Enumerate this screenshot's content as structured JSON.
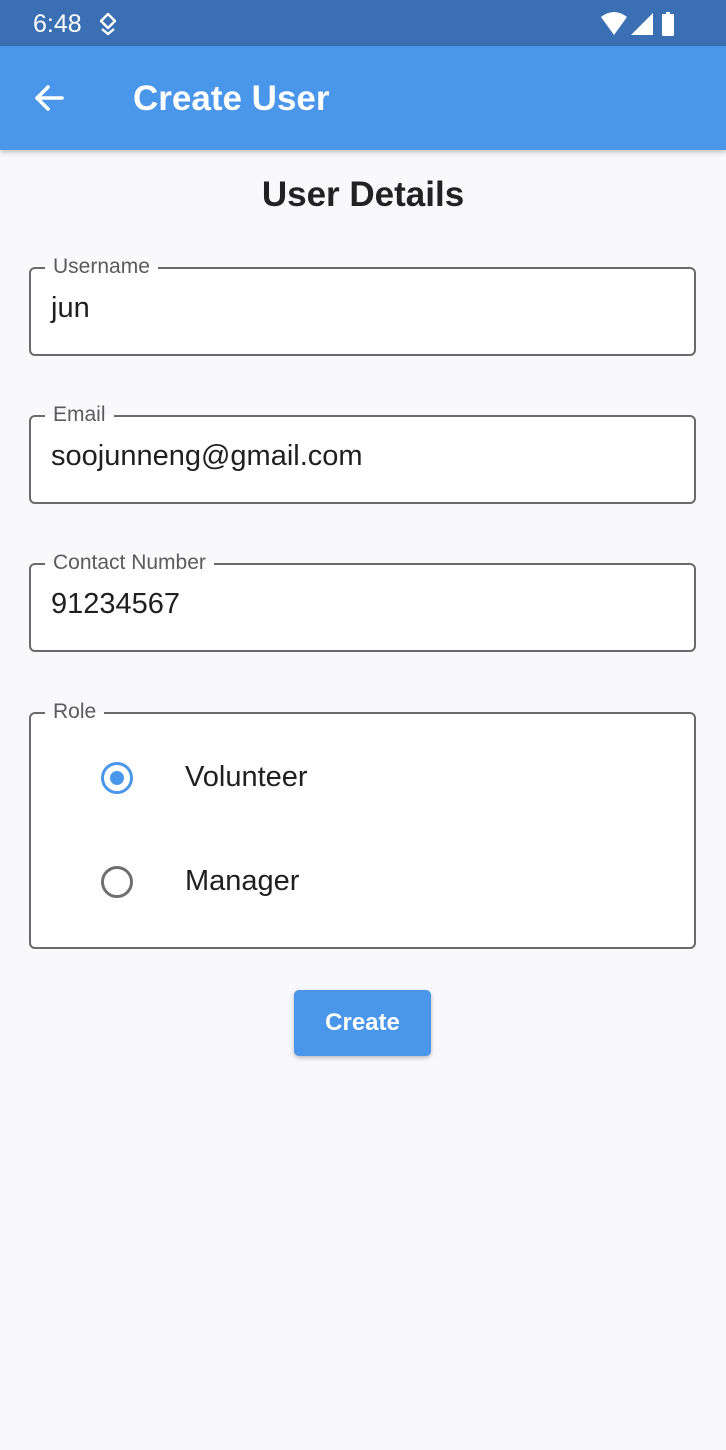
{
  "status_bar": {
    "time": "6:48",
    "icons": [
      "notification-icon",
      "wifi-icon",
      "signal-icon",
      "battery-icon"
    ]
  },
  "app_bar": {
    "title": "Create User",
    "back_icon": "arrow-back-icon",
    "color": "#4a96eb"
  },
  "form": {
    "section_title": "User Details",
    "username": {
      "label": "Username",
      "value": "jun"
    },
    "email": {
      "label": "Email",
      "value": "soojunneng@gmail.com"
    },
    "contact": {
      "label": "Contact Number",
      "value": "91234567"
    },
    "role": {
      "label": "Role",
      "options": [
        {
          "label": "Volunteer",
          "selected": true
        },
        {
          "label": "Manager",
          "selected": false
        }
      ]
    },
    "create_label": "Create"
  },
  "colors": {
    "accent": "#4a96eb",
    "status_bar": "#3a70b3",
    "background": "#f9f8fb"
  }
}
